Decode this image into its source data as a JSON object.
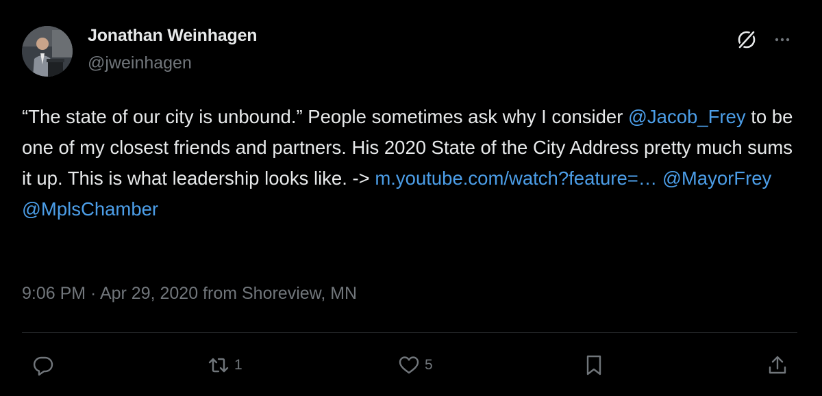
{
  "author": {
    "display_name": "Jonathan Weinhagen",
    "handle": "@jweinhagen"
  },
  "tweet": {
    "text_parts": [
      "“The state of our city is unbound.” People sometimes ask why I consider ",
      "@Jacob_Frey",
      " to be one of my closest friends and partners. His 2020 State of the City Address pretty much sums it up. This is what leadership looks like. -> ",
      "m.youtube.com/watch?feature=…",
      " ",
      "@MayorFrey",
      " ",
      "@MplsChamber"
    ],
    "timestamp": "9:06 PM · Apr 29, 2020 from Shoreview, MN"
  },
  "actions": {
    "reply_count": "",
    "retweet_count": "1",
    "like_count": "5"
  },
  "icons": {
    "header": [
      "grok-icon",
      "more-icon"
    ],
    "actions": [
      "reply-icon",
      "retweet-icon",
      "like-icon",
      "bookmark-icon",
      "share-icon"
    ]
  },
  "colors": {
    "background": "#000000",
    "primary_text": "#e7e9ea",
    "secondary_text": "#71767b",
    "link": "#4c9ee8",
    "divider": "#2f3336"
  }
}
